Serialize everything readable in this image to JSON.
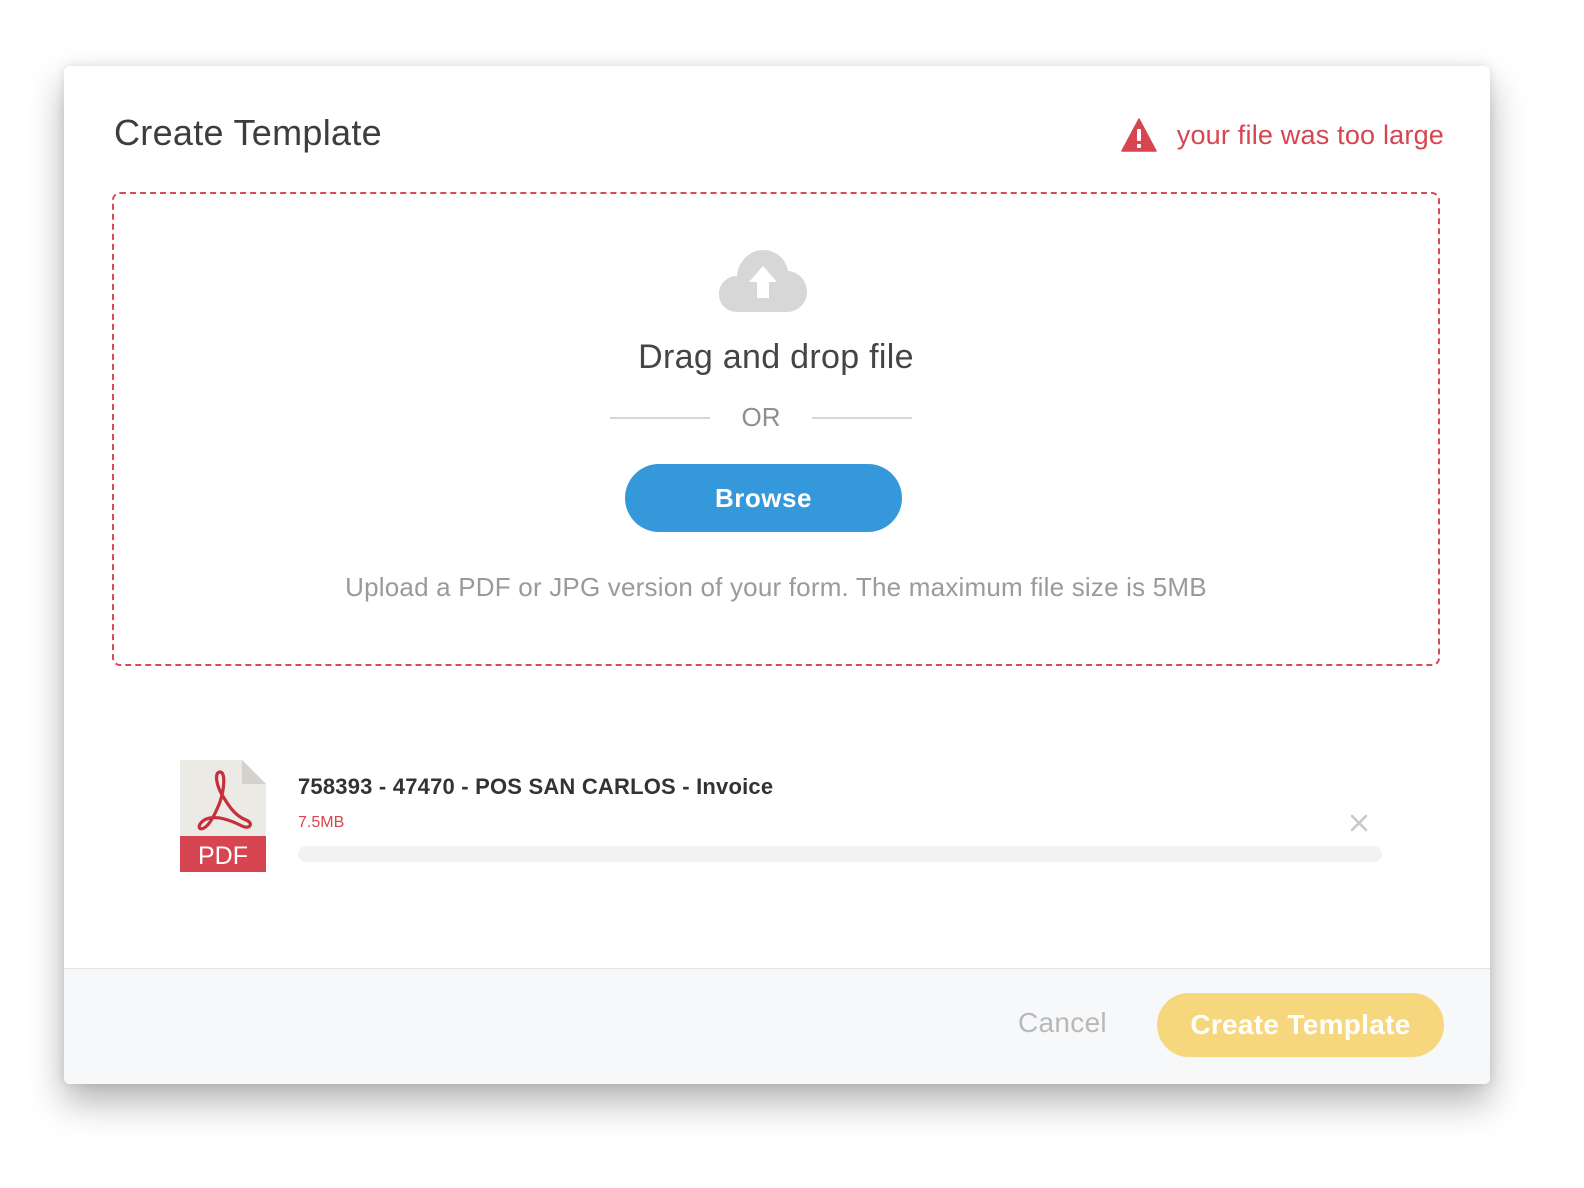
{
  "dialog": {
    "title": "Create Template"
  },
  "error": {
    "icon": "warning-triangle-icon",
    "message": "your file was too large",
    "color": "#d64550"
  },
  "dropzone": {
    "icon": "cloud-upload-icon",
    "heading": "Drag and drop file",
    "or_label": "OR",
    "browse_label": "Browse",
    "hint": "Upload a PDF or JPG version of your form. The maximum file size is 5MB",
    "border_color": "#d84a55"
  },
  "file": {
    "icon": "pdf-file-icon",
    "icon_label": "PDF",
    "name": "758393 - 47470 - POS SAN CARLOS - Invoice",
    "size": "7.5MB",
    "progress": 0,
    "remove_icon": "close-icon"
  },
  "footer": {
    "cancel_label": "Cancel",
    "create_label": "Create Template",
    "accent_color": "#f6d77e",
    "browse_color": "#3498db"
  }
}
